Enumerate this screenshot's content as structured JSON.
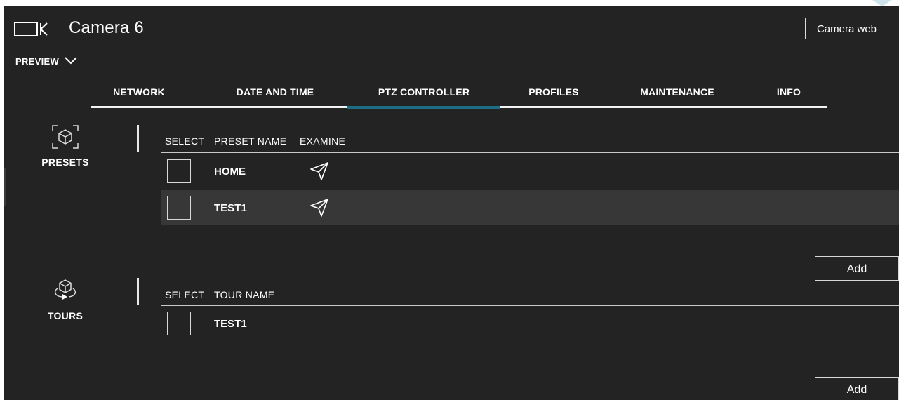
{
  "header": {
    "title": "Camera 6",
    "camera_web_label": "Camera web",
    "preview_label": "PREVIEW"
  },
  "tabs": [
    {
      "label": "NETWORK",
      "active": false
    },
    {
      "label": "DATE AND TIME",
      "active": false
    },
    {
      "label": "PTZ CONTROLLER",
      "active": true
    },
    {
      "label": "PROFILES",
      "active": false
    },
    {
      "label": "MAINTENANCE",
      "active": false
    },
    {
      "label": "INFO",
      "active": false
    }
  ],
  "presets": {
    "section_label": "PRESETS",
    "columns": [
      "SELECT",
      "PRESET NAME",
      "EXAMINE"
    ],
    "rows": [
      {
        "name": "HOME",
        "selected": false
      },
      {
        "name": "TEST1",
        "selected": false
      }
    ],
    "add_label": "Add"
  },
  "tours": {
    "section_label": "TOURS",
    "columns": [
      "SELECT",
      "TOUR NAME"
    ],
    "rows": [
      {
        "name": "TEST1",
        "selected": false
      }
    ],
    "add_label": "Add"
  },
  "colors": {
    "background": "#232323",
    "row_highlight": "#373737",
    "active_tab_underline": "#1d6e85",
    "text": "#ffffff"
  }
}
